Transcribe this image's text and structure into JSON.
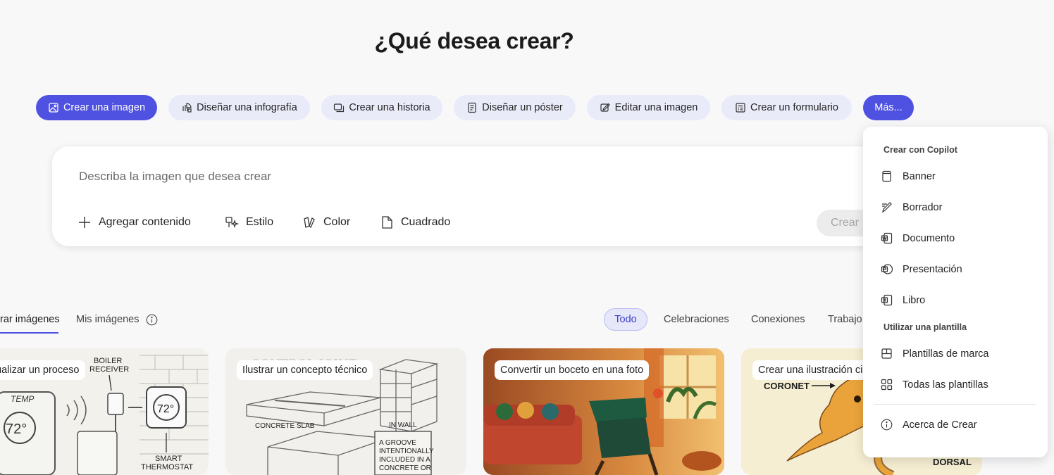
{
  "page": {
    "title": "¿Qué desea crear?"
  },
  "pills": [
    {
      "label": "Crear una imagen",
      "icon": "image-icon"
    },
    {
      "label": "Diseñar una infografía",
      "icon": "infographic-icon"
    },
    {
      "label": "Crear una historia",
      "icon": "story-icon"
    },
    {
      "label": "Diseñar un póster",
      "icon": "poster-icon"
    },
    {
      "label": "Editar una imagen",
      "icon": "edit-image-icon"
    },
    {
      "label": "Crear un formulario",
      "icon": "form-icon"
    },
    {
      "label": "Más..."
    }
  ],
  "prompt": {
    "placeholder": "Describa la imagen que desea crear",
    "add_content": "Agregar contenido",
    "style": "Estilo",
    "color": "Color",
    "aspect": "Cuadrado",
    "create": "Crear"
  },
  "gallery": {
    "tab_explore": "rar imágenes",
    "tab_mine": "Mis imágenes",
    "filters": [
      "Todo",
      "Celebraciones",
      "Conexiones",
      "Trabajo"
    ],
    "cards": [
      {
        "label": "ualizar un proceso",
        "art": {
          "boiler": "BOILER",
          "receiver": "RECEIVER",
          "temp": "TEMP",
          "temp_value": "72°",
          "dial_value": "72°",
          "smart": "SMART",
          "thermostat": "THERMOSTAT"
        }
      },
      {
        "label": "Ilustrar un concepto técnico",
        "art": {
          "top": "CONTROL JOINT",
          "slab": "CONCRETE SLAB",
          "wall": "IN WALL",
          "note": [
            "A GROOVE",
            "INTENTIONALLY",
            "INCLUDED IN A",
            "CONCRETE OR"
          ]
        }
      },
      {
        "label": "Convertir un boceto en una foto"
      },
      {
        "label": "Crear una ilustración cie",
        "art": {
          "coronet": "CORONET",
          "dorsal": "DORSAL"
        }
      }
    ]
  },
  "menu": {
    "section_copilot": "Crear con Copilot",
    "items_copilot": [
      {
        "label": "Banner",
        "icon": "banner-icon"
      },
      {
        "label": "Borrador",
        "icon": "draft-icon"
      },
      {
        "label": "Documento",
        "icon": "word-icon"
      },
      {
        "label": "Presentación",
        "icon": "powerpoint-icon"
      },
      {
        "label": "Libro",
        "icon": "excel-icon"
      }
    ],
    "section_template": "Utilizar una plantilla",
    "items_template": [
      {
        "label": "Plantillas de marca",
        "icon": "brand-templates-icon"
      },
      {
        "label": "Todas las plantillas",
        "icon": "all-templates-icon"
      }
    ],
    "about": "Acerca de Crear"
  },
  "colors": {
    "accent": "#4f52e0",
    "pill_bg": "#e9ebf9",
    "background": "#f8f8f9"
  }
}
